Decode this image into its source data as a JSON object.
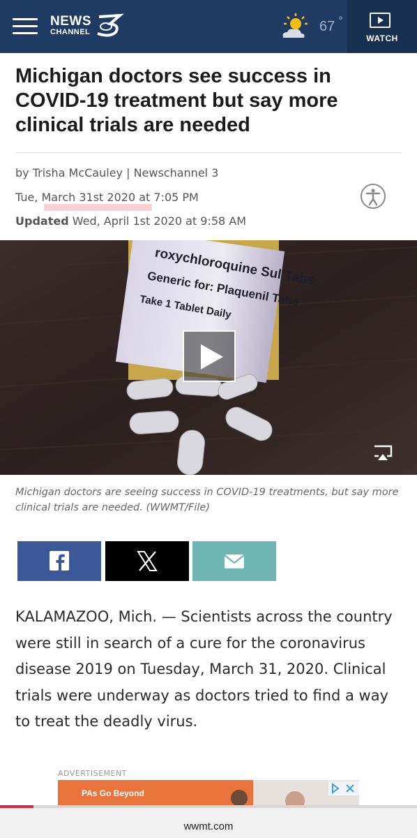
{
  "header": {
    "logo_line1": "NEWS",
    "logo_line2": "CHANNEL",
    "weather_temp": "67",
    "weather_unit": "°",
    "watch_label": "WATCH",
    "background": "#1f3b63"
  },
  "article": {
    "headline": "Michigan doctors see success in COVID-19 treatment but say more clinical trials are needed",
    "byline": "by Trisha McCauley | Newschannel 3",
    "published": "Tue, March 31st 2020 at 7:05 PM",
    "updated_label": "Updated",
    "updated_value": "Wed, April 1st 2020 at 9:58 AM",
    "caption": "Michigan doctors are seeing success in COVID-19 treatments, but say more clinical trials are needed. (WWMT/File)",
    "media_label_line1": "roxychloroquine Sul Tabs",
    "media_label_line2": "Generic for: Plaquenil Tabs",
    "media_label_line3": "Take 1 Tablet Daily",
    "body": "KALAMAZOO, Mich. — Scientists across the country were still in search of a cure for the coronavirus disease 2019 on Tuesday, March 31, 2020. Clinical trials were underway as doctors tried to find a way to treat the deadly virus."
  },
  "share": {
    "facebook_color": "#3b5998",
    "x_color": "#000000",
    "email_color": "#6eb5b3",
    "icons": [
      "facebook-icon",
      "x-icon",
      "email-icon"
    ]
  },
  "ad": {
    "label": "ADVERTISEMENT",
    "text": "PAs Go Beyond"
  },
  "browser": {
    "url": "wwmt.com",
    "read_progress": 0.08
  }
}
